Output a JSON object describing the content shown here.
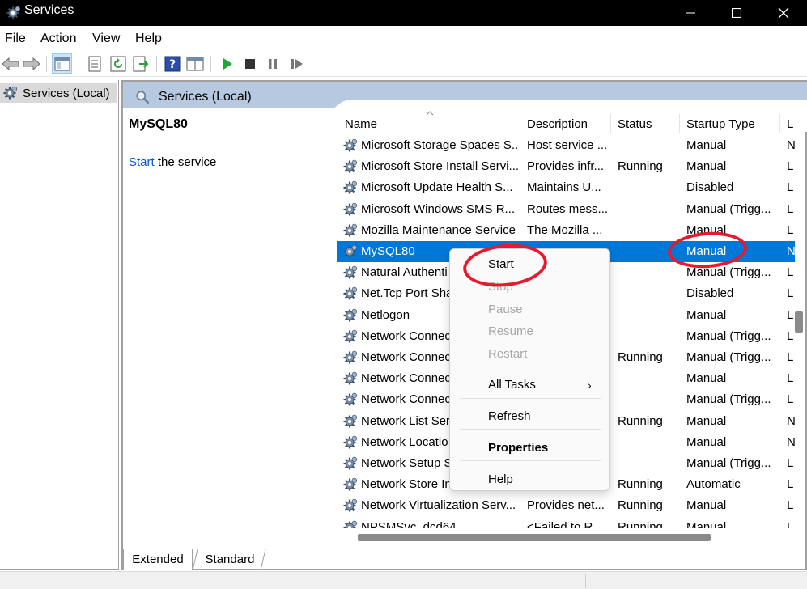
{
  "window": {
    "title": "Services"
  },
  "menu": [
    "File",
    "Action",
    "View",
    "Help"
  ],
  "tree": {
    "root_label": "Services (Local)"
  },
  "header": {
    "title": "Services (Local)"
  },
  "detail": {
    "service_name": "MySQL80",
    "action_link": "Start",
    "action_suffix": " the service"
  },
  "columns": [
    "Name",
    "Description",
    "Status",
    "Startup Type",
    "L"
  ],
  "rows": [
    {
      "name": "Microsoft Storage Spaces S...",
      "description": "Host service ...",
      "status": "",
      "startup": "Manual",
      "log": "N"
    },
    {
      "name": "Microsoft Store Install Servi...",
      "description": "Provides infr...",
      "status": "Running",
      "startup": "Manual",
      "log": "L"
    },
    {
      "name": "Microsoft Update Health S...",
      "description": "Maintains U...",
      "status": "",
      "startup": "Disabled",
      "log": "L"
    },
    {
      "name": "Microsoft Windows SMS R...",
      "description": "Routes mess...",
      "status": "",
      "startup": "Manual (Trigg...",
      "log": "L"
    },
    {
      "name": "Mozilla Maintenance Service",
      "description": "The Mozilla ...",
      "status": "",
      "startup": "Manual",
      "log": "L"
    },
    {
      "name": "MySQL80",
      "description": "",
      "status": "",
      "startup": "Manual",
      "log": "N"
    },
    {
      "name": "Natural Authenti",
      "description": "",
      "status": "",
      "startup": "Manual (Trigg...",
      "log": "L"
    },
    {
      "name": "Net.Tcp Port Sha",
      "description": "",
      "status": "",
      "startup": "Disabled",
      "log": "L"
    },
    {
      "name": "Netlogon",
      "description": "",
      "status": "",
      "startup": "Manual",
      "log": "L"
    },
    {
      "name": "Network Connec",
      "description": "",
      "status": "",
      "startup": "Manual (Trigg...",
      "log": "L"
    },
    {
      "name": "Network Connec",
      "description": "",
      "status": "Running",
      "startup": "Manual (Trigg...",
      "log": "L"
    },
    {
      "name": "Network Connec",
      "description": "",
      "status": "",
      "startup": "Manual",
      "log": "L"
    },
    {
      "name": "Network Connec",
      "description": "",
      "status": "",
      "startup": "Manual (Trigg...",
      "log": "L"
    },
    {
      "name": "Network List Ser",
      "description": "",
      "status": "Running",
      "startup": "Manual",
      "log": "N"
    },
    {
      "name": "Network Locatio",
      "description": "",
      "status": "",
      "startup": "Manual",
      "log": "N"
    },
    {
      "name": "Network Setup S",
      "description": "",
      "status": "",
      "startup": "Manual (Trigg...",
      "log": "L"
    },
    {
      "name": "Network Store In",
      "description": "",
      "status": "Running",
      "startup": "Automatic",
      "log": "L"
    },
    {
      "name": "Network Virtualization Serv...",
      "description": "Provides net...",
      "status": "Running",
      "startup": "Manual",
      "log": "L"
    },
    {
      "name": "NPSMSvc_dcd64",
      "description": "<Failed to R...",
      "status": "Running",
      "startup": "Manual",
      "log": "L"
    }
  ],
  "context_menu": {
    "start": "Start",
    "stop": "Stop",
    "pause": "Pause",
    "resume": "Resume",
    "restart": "Restart",
    "all_tasks": "All Tasks",
    "refresh": "Refresh",
    "properties": "Properties",
    "help": "Help"
  },
  "tabs": [
    "Extended",
    "Standard"
  ],
  "colors": {
    "selection": "#0078d7",
    "annotation": "#e8192c",
    "header_band": "#b7c9e0"
  },
  "icons": [
    "gears-icon",
    "back-arrow-icon",
    "forward-arrow-icon",
    "show-tree-icon",
    "export-list-icon",
    "refresh-icon",
    "export-icon",
    "help-icon",
    "console-icon",
    "play-icon",
    "stop-icon",
    "pause-icon",
    "resume-icon"
  ]
}
